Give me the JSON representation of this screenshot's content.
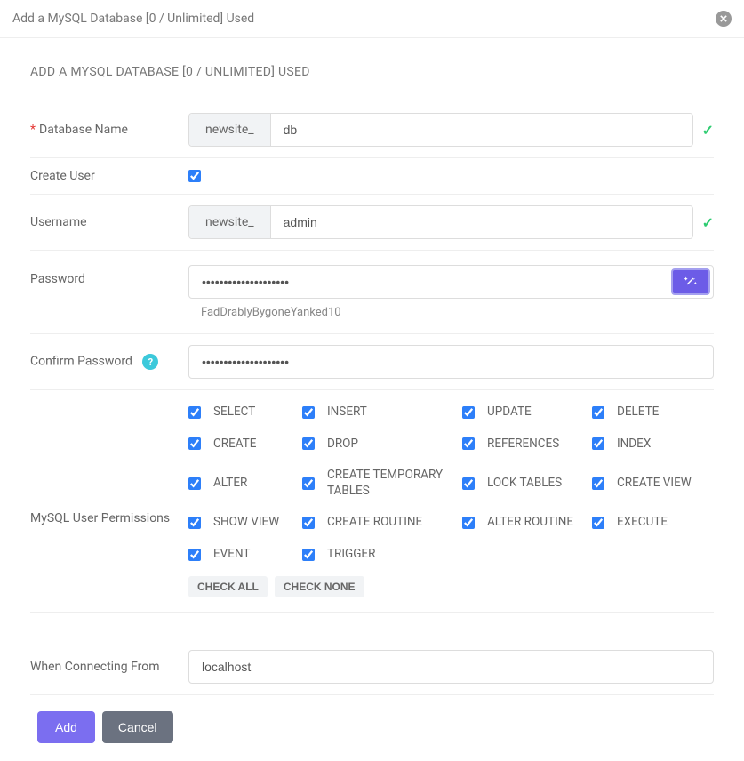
{
  "titlebar": {
    "title": "Add a MySQL Database [0 / Unlimited] Used"
  },
  "section_title": "ADD A MYSQL DATABASE [0 / UNLIMITED] USED",
  "fields": {
    "db_name": {
      "label": "Database Name",
      "prefix": "newsite_",
      "value": "db"
    },
    "create_user": {
      "label": "Create User",
      "checked": true
    },
    "username": {
      "label": "Username",
      "prefix": "newsite_",
      "value": "admin"
    },
    "password": {
      "label": "Password",
      "value": "••••••••••••••••••••",
      "plain": "FadDrablyBygoneYanked10"
    },
    "confirm": {
      "label": "Confirm Password",
      "value": "••••••••••••••••••••"
    },
    "perms_label": "MySQL User Permissions",
    "connecting": {
      "label": "When Connecting From",
      "value": "localhost"
    }
  },
  "permissions": [
    "SELECT",
    "INSERT",
    "UPDATE",
    "DELETE",
    "CREATE",
    "DROP",
    "REFERENCES",
    "INDEX",
    "ALTER",
    "CREATE TEMPORARY TABLES",
    "LOCK TABLES",
    "CREATE VIEW",
    "SHOW VIEW",
    "CREATE ROUTINE",
    "ALTER ROUTINE",
    "EXECUTE",
    "EVENT",
    "TRIGGER"
  ],
  "chips": {
    "check_all": "CHECK ALL",
    "check_none": "CHECK NONE"
  },
  "buttons": {
    "add": "Add",
    "cancel": "Cancel"
  }
}
